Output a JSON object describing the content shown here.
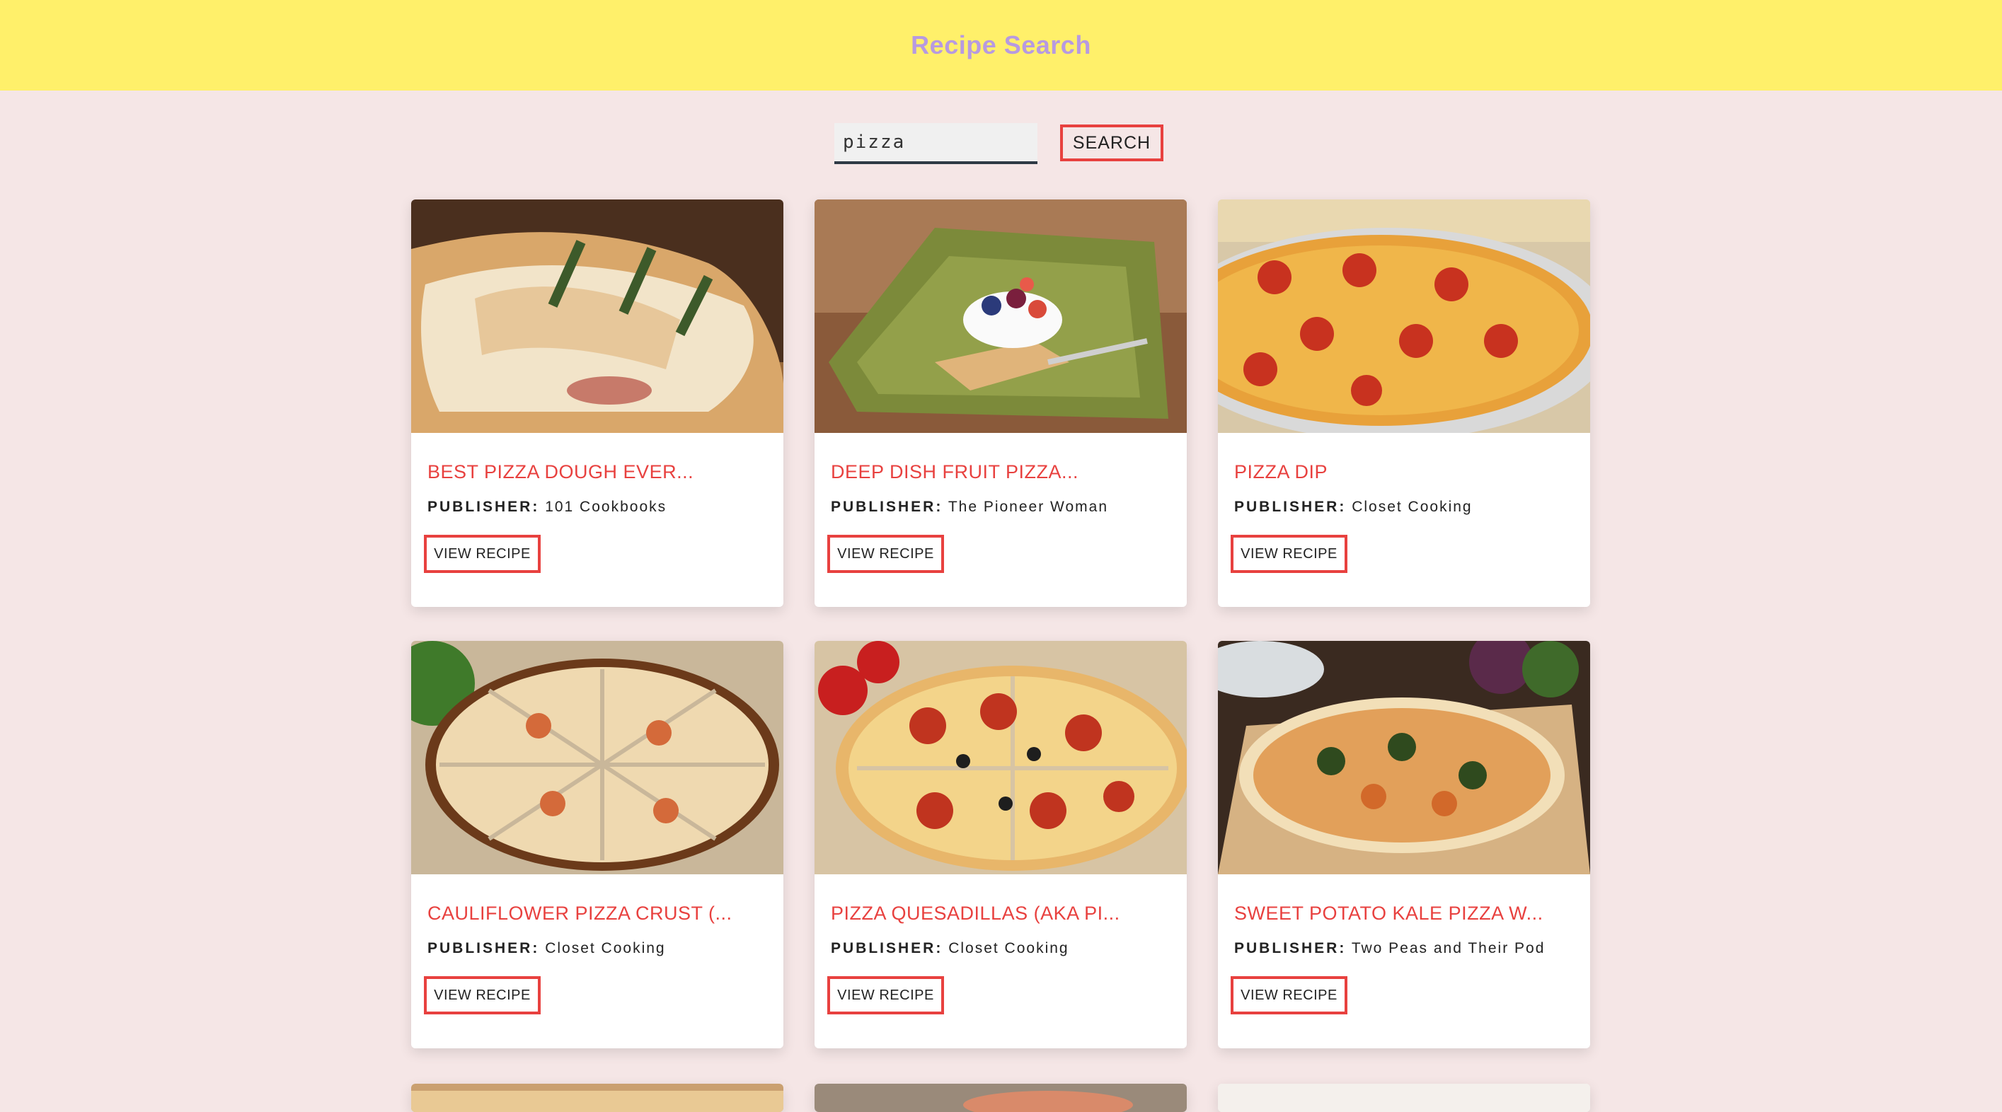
{
  "header": {
    "title": "Recipe Search"
  },
  "search": {
    "value": "pizza",
    "button_label": "SEARCH"
  },
  "recipes": [
    {
      "title": "BEST PIZZA DOUGH EVER...",
      "publisher_key": "PUBLISHER:",
      "publisher": "101 Cookbooks",
      "button_label": "VIEW RECIPE"
    },
    {
      "title": "DEEP DISH FRUIT PIZZA...",
      "publisher_key": "PUBLISHER:",
      "publisher": "The Pioneer Woman",
      "button_label": "VIEW RECIPE"
    },
    {
      "title": "PIZZA DIP",
      "publisher_key": "PUBLISHER:",
      "publisher": "Closet Cooking",
      "button_label": "VIEW RECIPE"
    },
    {
      "title": "CAULIFLOWER PIZZA CRUST (...",
      "publisher_key": "PUBLISHER:",
      "publisher": "Closet Cooking",
      "button_label": "VIEW RECIPE"
    },
    {
      "title": "PIZZA QUESADILLAS (AKA PI...",
      "publisher_key": "PUBLISHER:",
      "publisher": "Closet Cooking",
      "button_label": "VIEW RECIPE"
    },
    {
      "title": "SWEET POTATO KALE PIZZA W...",
      "publisher_key": "PUBLISHER:",
      "publisher": "Two Peas and Their Pod",
      "button_label": "VIEW RECIPE"
    }
  ],
  "colors": {
    "header_bg": "#fff06a",
    "header_text": "#b79ae0",
    "page_bg": "#f5e6e6",
    "accent": "#e8413f"
  }
}
